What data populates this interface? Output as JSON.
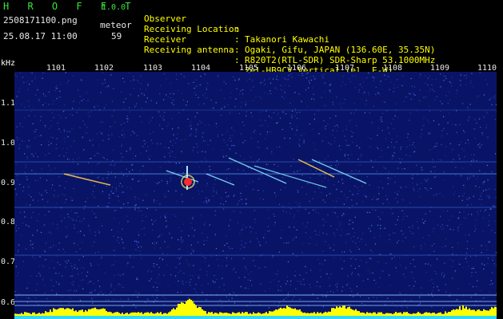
{
  "header": {
    "app_name": "H R O F F T",
    "version": "1.0.0",
    "filename": "2508171100.png",
    "datetime": "25.08.17 11:00",
    "meteor_label": "meteor",
    "meteor_count": "59"
  },
  "info": [
    {
      "key": "Observer",
      "colon": ":",
      "value": "Takanori Kawachi"
    },
    {
      "key": "Receiving Location",
      "colon": ":",
      "value": "Ogaki, Gifu, JAPAN (136.60E, 35.35N)"
    },
    {
      "key": "Receiver",
      "colon": ":",
      "value": "R820T2(RTL-SDR) SDR-Sharp 53.1000MHz"
    },
    {
      "key": "Receiving antenna",
      "colon": ":",
      "value": "2el-HB9CV Vertical (el. E-W)"
    }
  ],
  "axis": {
    "y_unit": "kHz",
    "y_ticks": [
      "1.1",
      "1.0",
      "0.9",
      "0.8",
      "0.7",
      "0.6"
    ],
    "x_ticks": [
      "1101",
      "1102",
      "1103",
      "1104",
      "1105",
      "1106",
      "1107",
      "1108",
      "1109",
      "1110"
    ]
  },
  "colors": {
    "background": "#000000",
    "spectrogram_bg": "#0a1466",
    "header_text": "#ffff00",
    "logo": "#39e539",
    "level_bars": "#ffff00",
    "floor": "#2fd8ff"
  }
}
